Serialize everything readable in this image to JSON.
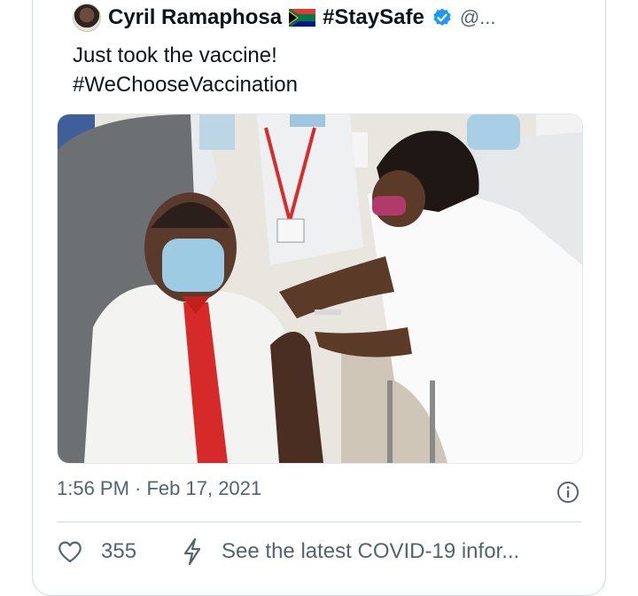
{
  "tweet": {
    "author_name": "Cyril Ramaphosa",
    "hashtag_label": "#StaySafe",
    "handle": "@...",
    "text_line1": "Just took the vaccine!",
    "text_line2": "#WeChooseVaccination",
    "timestamp": "1:56 PM · Feb 17, 2021",
    "like_count": "355",
    "covid_info_link": "See the latest COVID-19 infor..."
  },
  "colors": {
    "verified_blue": "#1d9bf0",
    "secondary_text": "#536471",
    "primary_text": "#0f1419",
    "divider": "#cfd9de"
  },
  "icons": [
    "avatar",
    "south-africa-flag-icon",
    "verified-badge-icon",
    "info-icon",
    "heart-icon",
    "lightning-bolt-icon"
  ]
}
